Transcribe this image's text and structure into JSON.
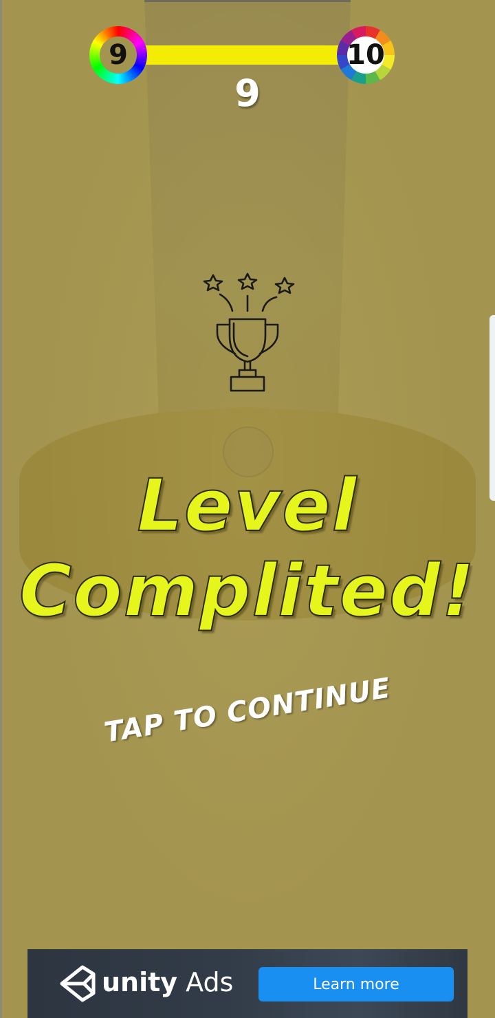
{
  "hud": {
    "current_level": "9",
    "next_level": "10",
    "score": "9",
    "progress": 1.0,
    "progress_color": "#f3ec06"
  },
  "result": {
    "title_line1": "Level",
    "title_line2": "Complited!",
    "title_color": "#e6f51c",
    "tap_prompt": "TAP TO CONTINUE"
  },
  "trophy": {
    "icon": "trophy-icon"
  },
  "ad": {
    "brand_icon": "unity-logo-icon",
    "brand_name": "unity",
    "brand_suffix": "Ads",
    "cta_label": "Learn more",
    "cta_color": "#1a8ff2"
  },
  "colors": {
    "background": "#a3944f"
  }
}
